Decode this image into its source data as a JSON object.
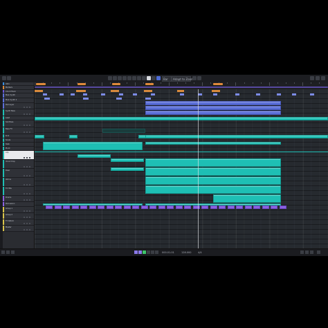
{
  "app": {
    "name": "DAW arrangement view",
    "accent": "#4d6cd6",
    "track_colors": {
      "teal": "#1ebfb4",
      "blue": "#5b6fd8",
      "purple": "#8b62e0",
      "orange": "#d98a3c",
      "yellow": "#d8c34a"
    }
  },
  "toolbar": {
    "snap_label": "Bar",
    "quantize_label": "Adapt to Zoom",
    "tool_icons": [
      "select-icon",
      "range-icon",
      "split-icon",
      "glue-icon",
      "erase-icon",
      "zoom-icon",
      "mute-icon",
      "draw-icon",
      "line-icon",
      "play-icon",
      "comp-icon"
    ]
  },
  "tracks": [
    {
      "name": "Intro",
      "color": "#3a8fe0"
    },
    {
      "name": "Markers",
      "color": "#d98a3c"
    },
    {
      "name": "Chord Track",
      "color": "#6f5bd6"
    },
    {
      "name": "Main Synth",
      "color": "#5b6fd8"
    },
    {
      "name": "Main Synth 2",
      "color": "#5b6fd8"
    },
    {
      "name": "Pad Layer",
      "color": "#5b6fd8"
    },
    {
      "name": "Synth Bass",
      "color": "#1ebfb4"
    },
    {
      "name": "Lead",
      "color": "#1ebfb4"
    },
    {
      "name": "Sub Bass",
      "color": "#1ebfb4"
    },
    {
      "name": "Bass FX",
      "color": "#1ebfb4"
    },
    {
      "name": "Kick",
      "color": "#1ebfb4"
    },
    {
      "name": "Snare",
      "color": "#1ebfb4"
    },
    {
      "name": "Stab",
      "color": "#1ebfb4"
    },
    {
      "name": "Pluck",
      "color": "#1ebfb4"
    },
    {
      "name": "Arp",
      "color": "#1ebfb4"
    },
    {
      "name": "Vocal Chop",
      "color": "#1ebfb4"
    },
    {
      "name": "Riser",
      "color": "#1ebfb4"
    },
    {
      "name": "Atmos",
      "color": "#1ebfb4"
    },
    {
      "name": "FX Hits",
      "color": "#1ebfb4"
    },
    {
      "name": "Drums",
      "color": "#8b62e0"
    },
    {
      "name": "Percussion",
      "color": "#8b62e0"
    },
    {
      "name": "Group 1",
      "color": "#d8c34a"
    },
    {
      "name": "Group 2",
      "color": "#d8c34a"
    },
    {
      "name": "FX Return",
      "color": "#d8c34a"
    },
    {
      "name": "Master",
      "color": "#d8c34a"
    }
  ],
  "status": {
    "time_display": "000.01.01",
    "tempo_label": "128.000",
    "signature": "4/4"
  }
}
